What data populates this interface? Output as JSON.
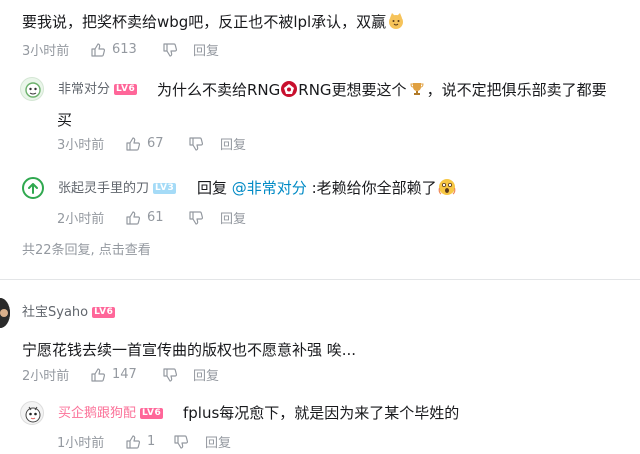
{
  "thread1": {
    "main_text": "要我说，把奖杯卖给wbg吧，反正也不被lpl承认，双赢",
    "main_time": "3小时前",
    "main_likes": "613",
    "reply_label": "回复",
    "replies": [
      {
        "user": "非常对分",
        "level": "LV6",
        "text_line1": "为什么不卖给RNG",
        "text_line1b": "RNG更想要这个",
        "text_line1c": "，说不定把俱乐部卖了都要",
        "text_line2": "买",
        "time": "3小时前",
        "likes": "67",
        "reply_label": "回复"
      },
      {
        "user": "张起灵手里的刀",
        "level": "LV3",
        "reply_prefix": "回复 ",
        "mention": "@非常对分",
        "text": " :老赖给你全部赖了",
        "time": "2小时前",
        "likes": "61",
        "reply_label": "回复"
      }
    ],
    "more_replies": "共22条回复, 点击查看"
  },
  "thread2": {
    "user": "社宝Syaho",
    "level": "LV6",
    "main_text": "宁愿花钱去续一首宣传曲的版权也不愿意补强 唉...",
    "main_time": "2小时前",
    "main_likes": "147",
    "reply_label": "回复",
    "replies": [
      {
        "user": "买企鹅跟狗配",
        "level": "LV6",
        "text": "fplus每况愈下，就是因为来了某个毕姓的",
        "time": "1小时前",
        "likes": "1",
        "reply_label": "回复"
      }
    ]
  },
  "colors": {
    "text": "#18191c",
    "meta": "#9499a0",
    "pink": "#fb7299",
    "mention": "#008ac5",
    "level6": "#ff6699",
    "level3": "#a5dbf7"
  }
}
